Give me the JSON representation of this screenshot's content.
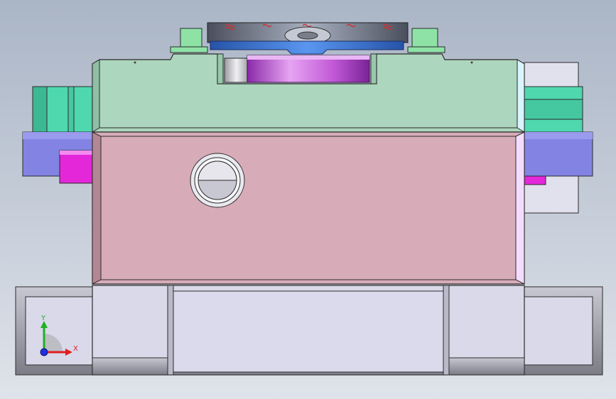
{
  "viewport": {
    "background_top": "#aab5c6",
    "background_bottom": "#dfe3ea"
  },
  "model": {
    "colors": {
      "top_plate": "#acd6bd",
      "middle_block": "#d7acb8",
      "base_rail": "#d9d9ea",
      "side_bar": "#8383e4",
      "side_block_green": "#4fd7ae",
      "magenta_tab": "#e327d9",
      "spindle_purple": "#c14ed8",
      "blue_disc": "#3a73d6",
      "edge": "#3c3c3c"
    }
  },
  "triad": {
    "x_label": "X",
    "y_label": "Y",
    "x_color": "#e02020",
    "y_color": "#20b020",
    "z_color": "#2030e0"
  }
}
